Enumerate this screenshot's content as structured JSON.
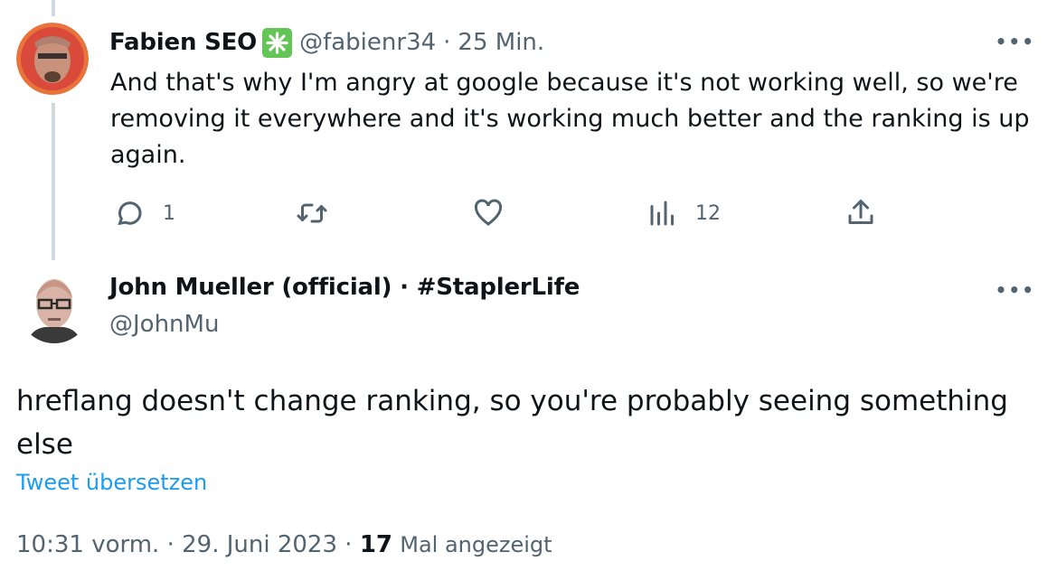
{
  "tweet1": {
    "author_name": "Fabien SEO",
    "handle": "@fabienr34",
    "separator": "·",
    "time": "25 Min.",
    "more_label": "•••",
    "text": "And that's why I'm angry at google because it's not working well, so we're removing it everywhere and it's working much better and the ranking is up again.",
    "actions": {
      "replies_count": "1",
      "views_count": "12"
    },
    "verified_icon": "checkmark-badge-icon",
    "accent_color": "#62c555"
  },
  "tweet2": {
    "author_name": "John Mueller (official) · #StaplerLife",
    "handle": "@JohnMu",
    "more_label": "•••",
    "text": "hreflang doesn't change ranking, so you're probably seeing something else",
    "translate_label": "Tweet übersetzen",
    "meta": {
      "time": "10:31 vorm.",
      "separator1": "·",
      "date": "29. Juni 2023",
      "separator2": "·",
      "views_count": "17",
      "views_label": "Mal angezeigt"
    }
  },
  "colors": {
    "link": "#1d9bf0",
    "muted": "#536471",
    "thread_line": "#cfd9de"
  }
}
